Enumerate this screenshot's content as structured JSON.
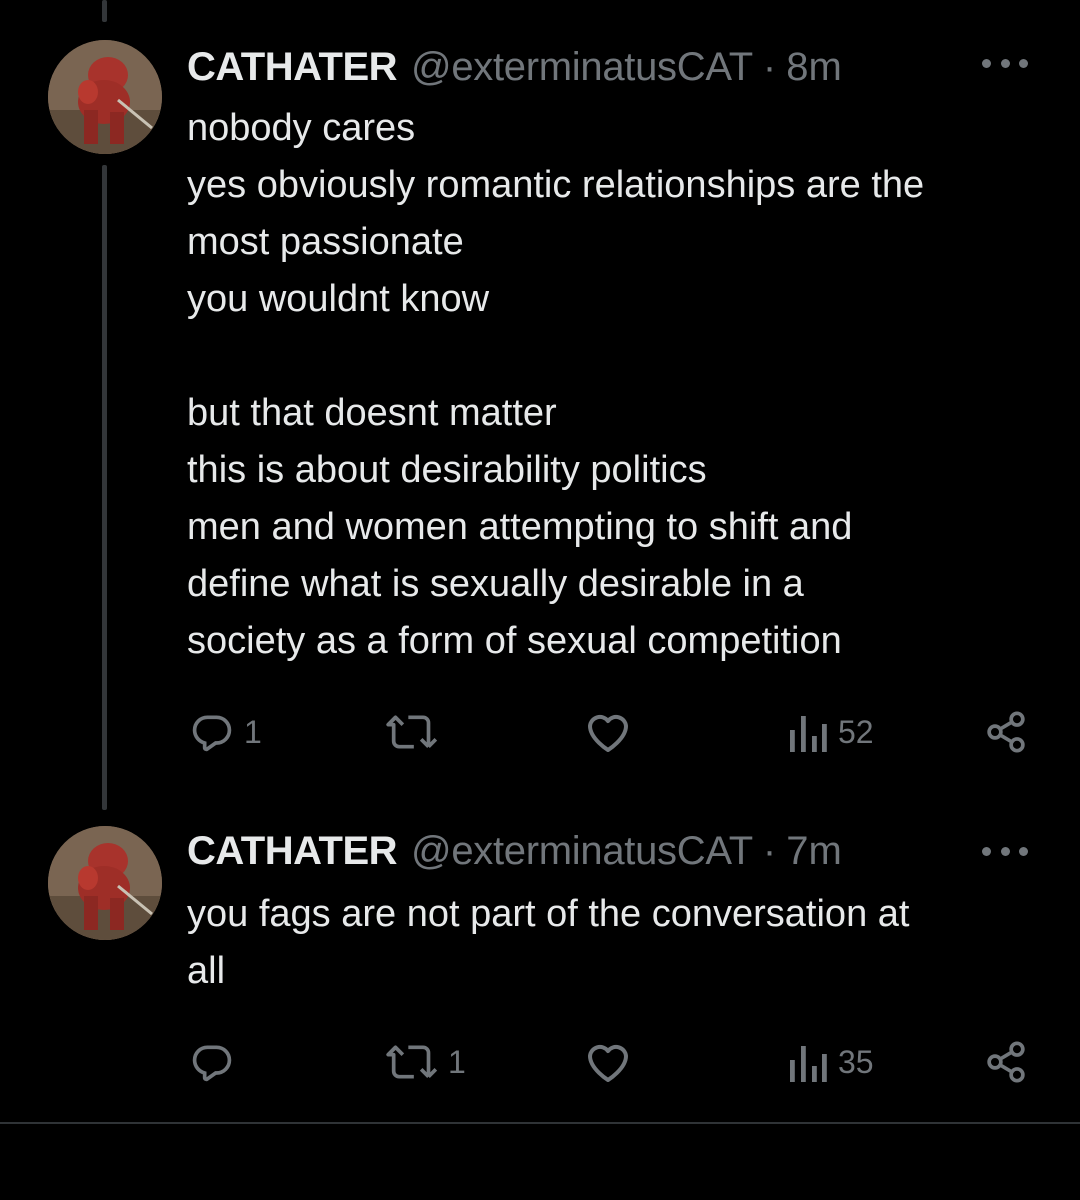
{
  "tweets": [
    {
      "display_name": "CATHATER",
      "handle": "@exterminatusCAT",
      "separator": "·",
      "time": "8m",
      "lines": [
        "nobody cares",
        "yes obviously romantic relationships are the",
        "most passionate",
        "you wouldnt know",
        "",
        "but that doesnt matter",
        "this is about desirability politics",
        "men and women attempting to shift and",
        "define what is sexually desirable in a",
        "society as a form of sexual competition"
      ],
      "reply_count": "1",
      "retweet_count": "",
      "like_count": "",
      "view_count": "52"
    },
    {
      "display_name": "CATHATER",
      "handle": "@exterminatusCAT",
      "separator": "·",
      "time": "7m",
      "lines": [
        "you fags are not part of the conversation at",
        "all"
      ],
      "reply_count": "",
      "retweet_count": "1",
      "like_count": "",
      "view_count": "35"
    }
  ],
  "icons": {
    "reply": "reply-icon",
    "retweet": "retweet-icon",
    "like": "heart-icon",
    "views": "views-icon",
    "share": "share-icon",
    "more": "more-icon"
  },
  "colors": {
    "background": "#000000",
    "text_primary": "#e7e9ea",
    "text_secondary": "#71767b",
    "thread_line": "#333639",
    "divider": "#2f3336"
  }
}
